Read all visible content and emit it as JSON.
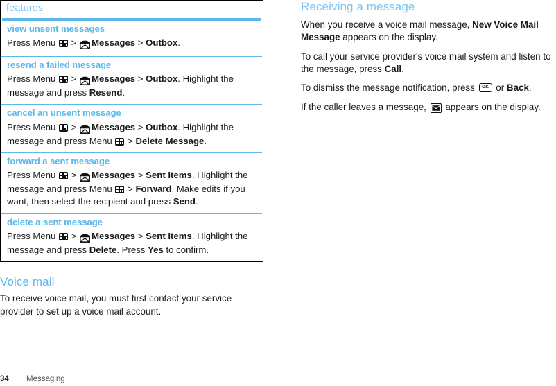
{
  "page": {
    "number": "34",
    "chapter": "Messaging"
  },
  "features_table": {
    "header": "features",
    "rows": [
      {
        "title": "view unsent messages",
        "body_parts": [
          {
            "t": "text",
            "v": "Press Menu "
          },
          {
            "t": "icon",
            "v": "menu-key-icon"
          },
          {
            "t": "text",
            "v": " > "
          },
          {
            "t": "icon",
            "v": "messages-envelope-icon"
          },
          {
            "t": "bold",
            "v": "Messages"
          },
          {
            "t": "text",
            "v": " > "
          },
          {
            "t": "bold",
            "v": "Outbox"
          },
          {
            "t": "text",
            "v": "."
          }
        ]
      },
      {
        "title": "resend a failed message",
        "body_parts": [
          {
            "t": "text",
            "v": "Press Menu "
          },
          {
            "t": "icon",
            "v": "menu-key-icon"
          },
          {
            "t": "text",
            "v": " > "
          },
          {
            "t": "icon",
            "v": "messages-envelope-icon"
          },
          {
            "t": "bold",
            "v": "Messages"
          },
          {
            "t": "text",
            "v": " > "
          },
          {
            "t": "bold",
            "v": "Outbox"
          },
          {
            "t": "text",
            "v": ". Highlight the message and press "
          },
          {
            "t": "bold",
            "v": "Resend"
          },
          {
            "t": "text",
            "v": "."
          }
        ]
      },
      {
        "title": "cancel an unsent message",
        "body_parts": [
          {
            "t": "text",
            "v": "Press Menu "
          },
          {
            "t": "icon",
            "v": "menu-key-icon"
          },
          {
            "t": "text",
            "v": " > "
          },
          {
            "t": "icon",
            "v": "messages-envelope-icon"
          },
          {
            "t": "bold",
            "v": "Messages"
          },
          {
            "t": "text",
            "v": " > "
          },
          {
            "t": "bold",
            "v": "Outbox"
          },
          {
            "t": "text",
            "v": ". Highlight the message and press Menu "
          },
          {
            "t": "icon",
            "v": "menu-key-icon"
          },
          {
            "t": "text",
            "v": " > "
          },
          {
            "t": "bold",
            "v": "Delete Message"
          },
          {
            "t": "text",
            "v": "."
          }
        ]
      },
      {
        "title": "forward a sent message",
        "body_parts": [
          {
            "t": "text",
            "v": "Press Menu "
          },
          {
            "t": "icon",
            "v": "menu-key-icon"
          },
          {
            "t": "text",
            "v": " > "
          },
          {
            "t": "icon",
            "v": "messages-envelope-icon"
          },
          {
            "t": "bold",
            "v": "Messages"
          },
          {
            "t": "text",
            "v": " > "
          },
          {
            "t": "bold",
            "v": "Sent Items"
          },
          {
            "t": "text",
            "v": ". Highlight the message and press Menu "
          },
          {
            "t": "icon",
            "v": "menu-key-icon"
          },
          {
            "t": "text",
            "v": " > "
          },
          {
            "t": "bold",
            "v": "Forward"
          },
          {
            "t": "text",
            "v": ". Make edits if you want, then select the recipient and press "
          },
          {
            "t": "bold",
            "v": "Send"
          },
          {
            "t": "text",
            "v": "."
          }
        ]
      },
      {
        "title": "delete a sent message",
        "body_parts": [
          {
            "t": "text",
            "v": "Press Menu "
          },
          {
            "t": "icon",
            "v": "menu-key-icon"
          },
          {
            "t": "text",
            "v": " > "
          },
          {
            "t": "icon",
            "v": "messages-envelope-icon"
          },
          {
            "t": "bold",
            "v": "Messages"
          },
          {
            "t": "text",
            "v": " > "
          },
          {
            "t": "bold",
            "v": "Sent Items"
          },
          {
            "t": "text",
            "v": ". Highlight the message and press "
          },
          {
            "t": "bold",
            "v": "Delete"
          },
          {
            "t": "text",
            "v": ". Press "
          },
          {
            "t": "bold",
            "v": "Yes"
          },
          {
            "t": "text",
            "v": " to confirm."
          }
        ]
      }
    ]
  },
  "voice_mail_section": {
    "heading": "Voice mail",
    "paragraphs": [
      [
        {
          "t": "text",
          "v": "To receive voice mail, you must first contact your service provider to set up a voice mail account."
        }
      ]
    ]
  },
  "receiving_section": {
    "heading": "Receiving a message",
    "paragraphs": [
      [
        {
          "t": "text",
          "v": "When you receive a voice mail message, "
        },
        {
          "t": "bold",
          "v": "New Voice Mail Message"
        },
        {
          "t": "text",
          "v": " appears on the display."
        }
      ],
      [
        {
          "t": "text",
          "v": "To call your service provider's voice mail system and listen to the message, press "
        },
        {
          "t": "bold",
          "v": "Call"
        },
        {
          "t": "text",
          "v": "."
        }
      ],
      [
        {
          "t": "text",
          "v": "To dismiss the message notification, press "
        },
        {
          "t": "icon",
          "v": "ok-key-icon"
        },
        {
          "t": "text",
          "v": " or "
        },
        {
          "t": "bold",
          "v": "Back"
        },
        {
          "t": "text",
          "v": "."
        }
      ],
      [
        {
          "t": "text",
          "v": "If the caller leaves a message, "
        },
        {
          "t": "icon",
          "v": "voicemail-envelope-icon"
        },
        {
          "t": "text",
          "v": " appears on the display."
        }
      ]
    ]
  },
  "icons": {
    "menu-key-icon": {
      "label": "OK",
      "kind": "menu"
    },
    "messages-envelope-icon": {
      "label": "",
      "kind": "envelope-open"
    },
    "ok-key-icon": {
      "label": "OK",
      "kind": "okkey"
    },
    "voicemail-envelope-icon": {
      "label": "",
      "kind": "envelope-boxed"
    }
  },
  "colors": {
    "accent_blue": "#5bb8e8",
    "accent_blue_light": "#7ec5ef",
    "text": "#1a1a1a",
    "border": "#000000"
  }
}
